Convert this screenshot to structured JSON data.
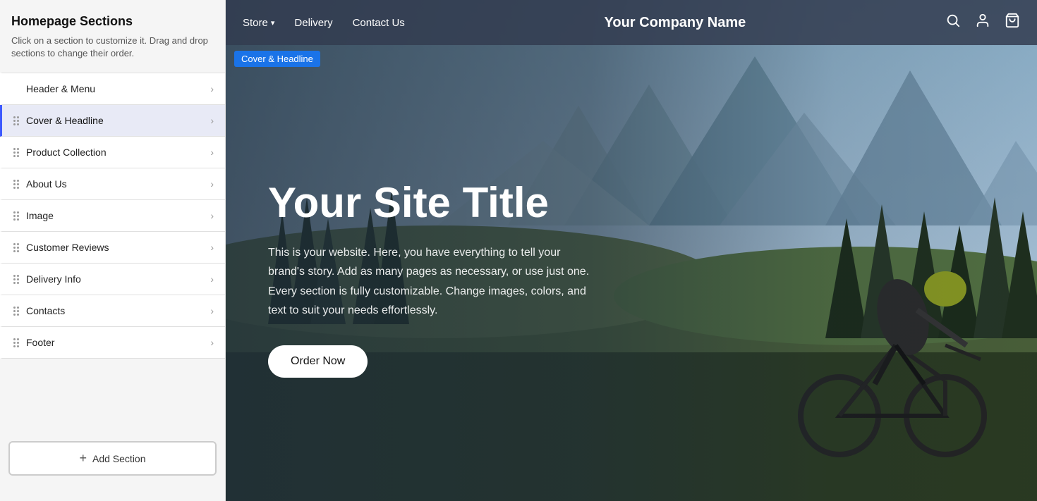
{
  "panel": {
    "title": "Homepage Sections",
    "description": "Click on a section to customize it. Drag and drop sections to change their order.",
    "sections": [
      {
        "id": "header-menu",
        "label": "Header & Menu",
        "draggable": false,
        "active": false
      },
      {
        "id": "cover-headline",
        "label": "Cover & Headline",
        "draggable": true,
        "active": true
      },
      {
        "id": "product-collection",
        "label": "Product Collection",
        "draggable": true,
        "active": false
      },
      {
        "id": "about-us",
        "label": "About Us",
        "draggable": true,
        "active": false
      },
      {
        "id": "image",
        "label": "Image",
        "draggable": true,
        "active": false
      },
      {
        "id": "customer-reviews",
        "label": "Customer Reviews",
        "draggable": true,
        "active": false
      },
      {
        "id": "delivery-info",
        "label": "Delivery Info",
        "draggable": true,
        "active": false
      },
      {
        "id": "contacts",
        "label": "Contacts",
        "draggable": true,
        "active": false
      },
      {
        "id": "footer",
        "label": "Footer",
        "draggable": true,
        "active": false
      }
    ],
    "add_section_label": "Add Section"
  },
  "nav": {
    "links": [
      {
        "label": "Store",
        "dropdown": true
      },
      {
        "label": "Delivery",
        "dropdown": false
      },
      {
        "label": "Contact Us",
        "dropdown": false
      }
    ],
    "brand": "Your Company Name",
    "icons": [
      "search",
      "account",
      "cart"
    ]
  },
  "hero": {
    "cover_tag": "Cover & Headline",
    "title": "Your Site Title",
    "subtitle": "This is your website. Here, you have everything to tell your brand's story. Add as many pages as necessary, or use just one. Every section is fully customizable. Change images, colors, and text to suit your needs effortlessly.",
    "cta_label": "Order Now"
  },
  "colors": {
    "active_item_bg": "#e8eaf6",
    "active_border": "#3d5afe",
    "cover_tag_bg": "#1a73e8",
    "nav_bg": "rgba(50,60,80,0.85)"
  }
}
